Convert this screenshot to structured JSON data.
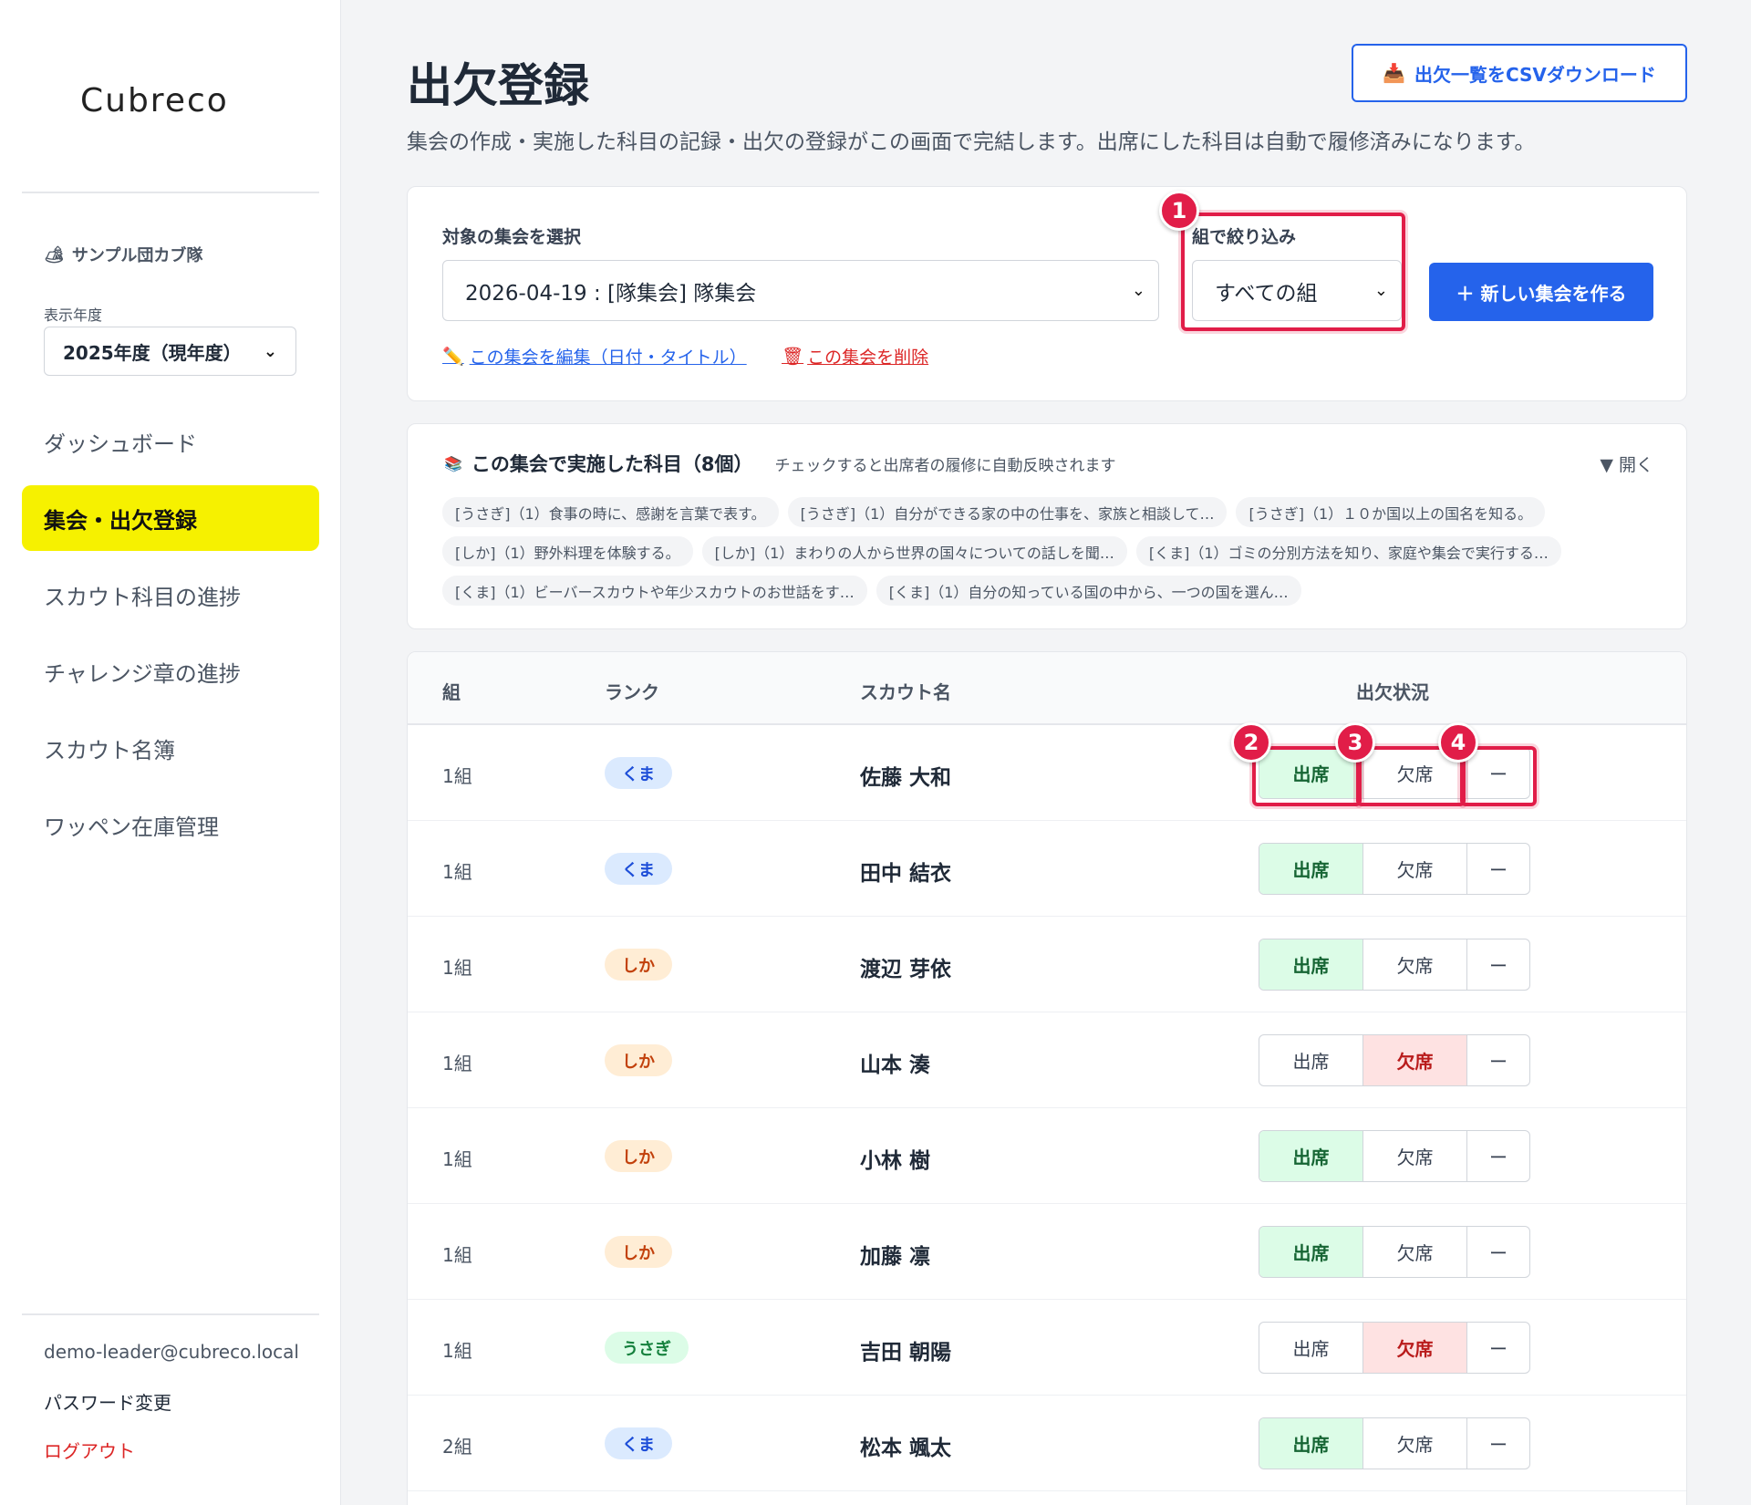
{
  "sidebar": {
    "logo": "Cubreco",
    "troop_emoji": "🏕",
    "troop_name": "サンプル団カブ隊",
    "year_label": "表示年度",
    "year_value": "2025年度（現年度）",
    "nav": [
      {
        "label": "ダッシュボード",
        "active": false
      },
      {
        "label": "集会・出欠登録",
        "active": true
      },
      {
        "label": "スカウト科目の進捗",
        "active": false
      },
      {
        "label": "チャレンジ章の進捗",
        "active": false
      },
      {
        "label": "スカウト名簿",
        "active": false
      },
      {
        "label": "ワッペン在庫管理",
        "active": false
      }
    ],
    "email": "demo-leader@cubreco.local",
    "password_change": "パスワード変更",
    "logout": "ログアウト"
  },
  "header": {
    "title": "出欠登録",
    "csv_icon": "📥",
    "csv_label": "出欠一覧をCSVダウンロード",
    "description": "集会の作成・実施した科目の記録・出欠の登録がこの画面で完結します。出席にした科目は自動で履修済みになります。"
  },
  "meeting": {
    "select_label": "対象の集会を選択",
    "selected": "2026-04-19 : [隊集会] 隊集会",
    "filter_label": "組で絞り込み",
    "filter_value": "すべての組",
    "new_button": "＋ 新しい集会を作る",
    "edit_icon": "✏️",
    "edit_link": "この集会を編集（日付・タイトル）",
    "delete_icon": "🗑",
    "delete_link": "この集会を削除"
  },
  "subjects": {
    "icon": "📚",
    "title": "この集会で実施した科目（8個）",
    "note": "チェックすると出席者の履修に自動反映されます",
    "toggle": "▼ 開く",
    "items": [
      "[うさぎ]（1）食事の時に、感謝を言葉で表す。",
      "[うさぎ]（1）自分ができる家の中の仕事を、家族と相談して…",
      "[うさぎ]（1）１０か国以上の国名を知る。",
      "[しか]（1）野外料理を体験する。",
      "[しか]（1）まわりの人から世界の国々についての話しを聞…",
      "[くま]（1）ゴミの分別方法を知り、家庭や集会で実行する…",
      "[くま]（1）ビーバースカウトや年少スカウトのお世話をす…",
      "[くま]（1）自分の知っている国の中から、一つの国を選ん…"
    ]
  },
  "table": {
    "headers": {
      "group": "組",
      "rank": "ランク",
      "name": "スカウト名",
      "status": "出欠状況"
    },
    "present_label": "出席",
    "absent_label": "欠席",
    "none_label": "ー",
    "rows": [
      {
        "group": "1組",
        "rank": "くま",
        "rank_type": "kuma",
        "name": "佐藤 大和",
        "status": "present"
      },
      {
        "group": "1組",
        "rank": "くま",
        "rank_type": "kuma",
        "name": "田中 結衣",
        "status": "present"
      },
      {
        "group": "1組",
        "rank": "しか",
        "rank_type": "shika",
        "name": "渡辺 芽依",
        "status": "present"
      },
      {
        "group": "1組",
        "rank": "しか",
        "rank_type": "shika",
        "name": "山本 湊",
        "status": "absent"
      },
      {
        "group": "1組",
        "rank": "しか",
        "rank_type": "shika",
        "name": "小林 樹",
        "status": "present"
      },
      {
        "group": "1組",
        "rank": "しか",
        "rank_type": "shika",
        "name": "加藤 凛",
        "status": "present"
      },
      {
        "group": "1組",
        "rank": "うさぎ",
        "rank_type": "usagi",
        "name": "吉田 朝陽",
        "status": "absent"
      },
      {
        "group": "2組",
        "rank": "くま",
        "rank_type": "kuma",
        "name": "松本 颯太",
        "status": "present"
      }
    ]
  },
  "markers": [
    "1",
    "2",
    "3",
    "4"
  ],
  "colors": {
    "primary": "#2563eb",
    "active_nav": "#f6f100",
    "highlight": "#e11d48",
    "present_bg": "#dcfce7",
    "absent_bg": "#fee2e2"
  }
}
